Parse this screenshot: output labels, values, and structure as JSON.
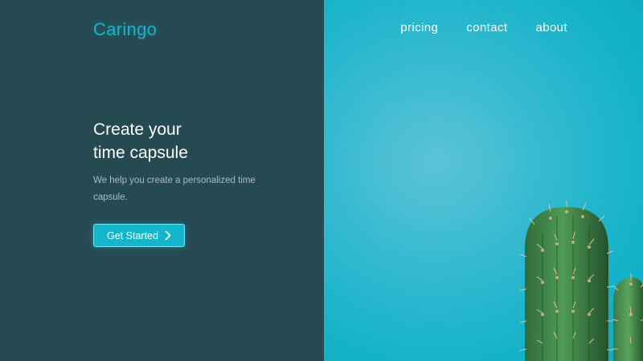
{
  "brand": {
    "name": "Caringo"
  },
  "nav": {
    "items": [
      {
        "label": "pricing"
      },
      {
        "label": "contact"
      },
      {
        "label": "about"
      }
    ]
  },
  "hero": {
    "title_line1": "Create your",
    "title_line2": "time capsule",
    "subtitle": "We help you create a personalized time capsule.",
    "cta_label": "Get Started",
    "cta_icon": "chevron-right-icon"
  },
  "colors": {
    "left_panel": "#264a52",
    "right_panel": "#12b2c8",
    "accent": "#14b6cc",
    "logo": "#1bb2c9"
  }
}
